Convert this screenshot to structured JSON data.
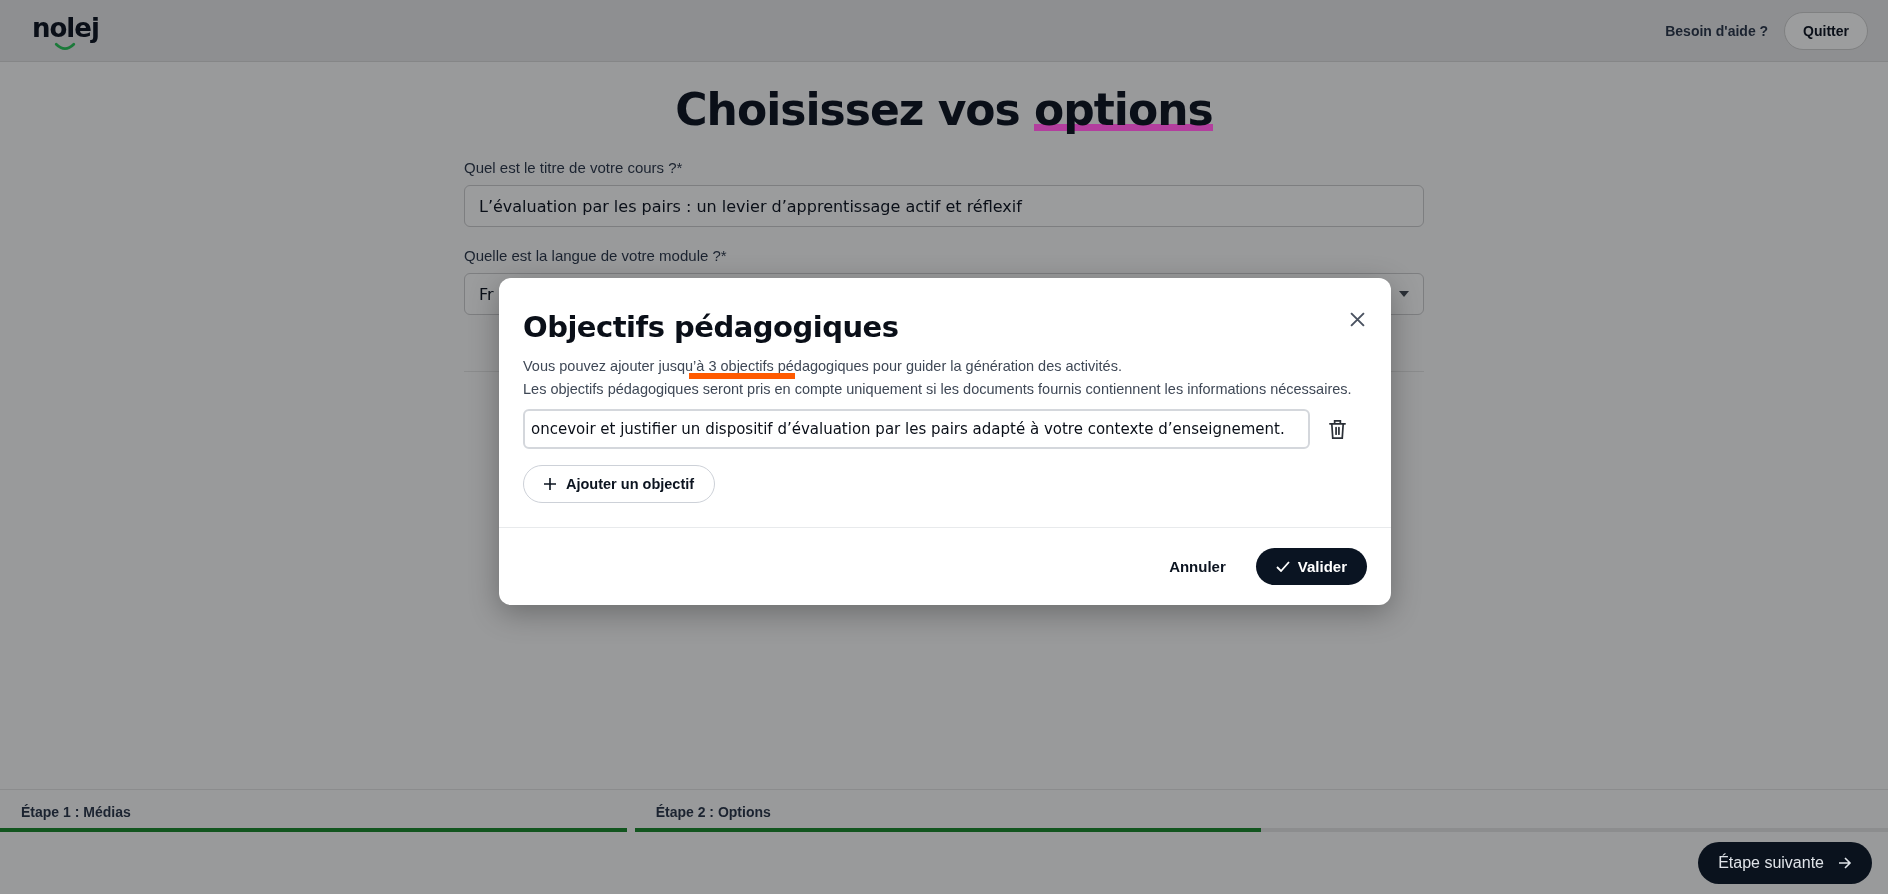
{
  "header": {
    "logo": "nolej",
    "help_link": "Besoin d'aide ?",
    "quit_button": "Quitter"
  },
  "page": {
    "title": "Choisissez vos",
    "title_emphasis": "options",
    "fields": [
      {
        "kind": "text",
        "label": "Quel est le titre de votre cours ?*",
        "value": "L’évaluation par les pairs : un levier d’apprentissage actif et réflexif"
      },
      {
        "kind": "select",
        "label": "Quelle est la langue de votre module ?*",
        "value": "Fr"
      }
    ]
  },
  "dialog": {
    "title": "Objectifs pédagogiques",
    "description": [
      "Vous pouvez ajouter jusqu’à 3 objectifs pédagogiques pour guider la génération des activités.",
      "Les objectifs pédagogiques seront pris en compte uniquement si les documents fournis contiennent les informations nécessaires."
    ],
    "objectives": [
      {
        "value": "oncevoir et justifier un dispositif d’évaluation par les pairs adapté à votre contexte d’enseignement."
      }
    ],
    "add_button": "Ajouter un objectif",
    "cancel_button": "Annuler",
    "confirm_button": "Valider"
  },
  "steps": [
    {
      "label": "Étape 1 : Médias",
      "level": 1
    },
    {
      "label": "Étape 2 : Options",
      "level": 0.5
    }
  ],
  "next_button": "Étape suivante"
}
